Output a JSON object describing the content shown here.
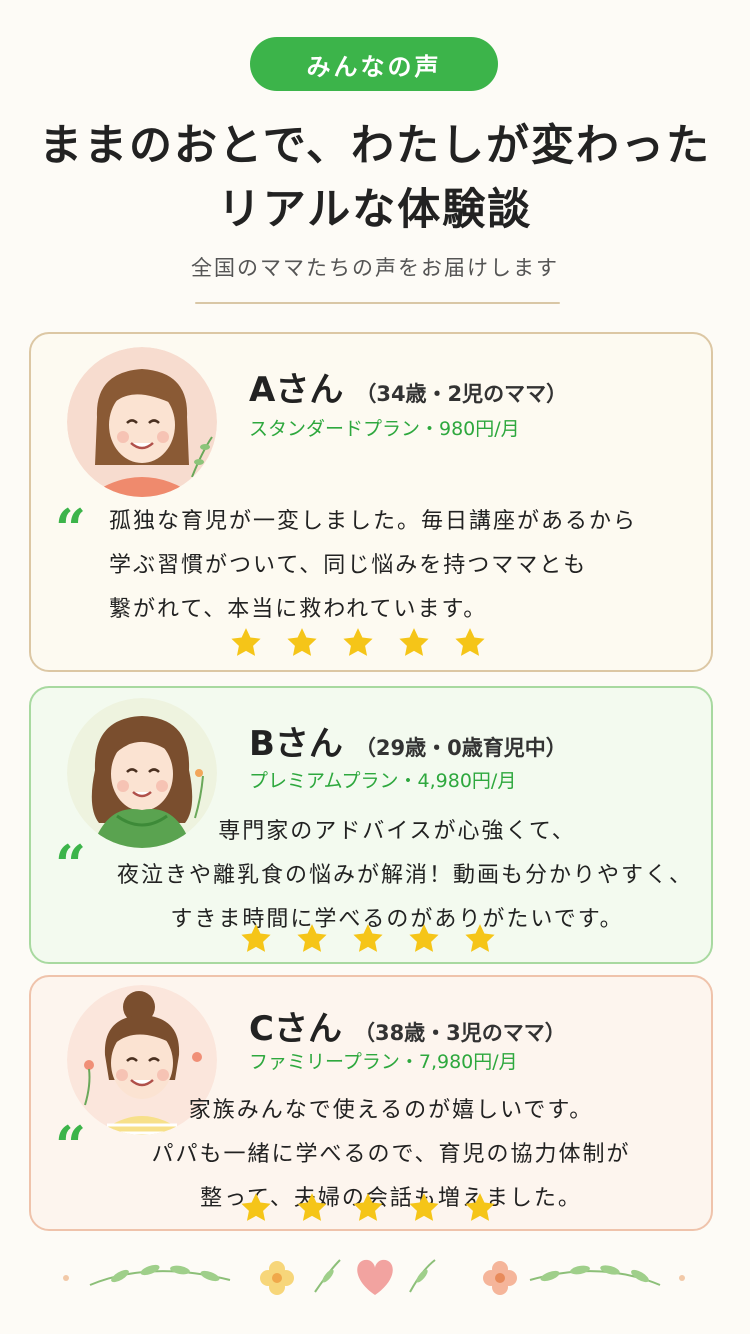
{
  "header": {
    "badge": "みんなの声",
    "title_line1": "ままのおとで、わたしが変わった",
    "title_line2": "リアルな体験談",
    "subtitle": "全国のママたちの声をお届けします"
  },
  "quote_glyph": "“",
  "testimonials": [
    {
      "name": "Aさん",
      "detail": "（34歳・2児のママ）",
      "plan": "スタンダードプラン・980円/月",
      "lines": [
        "孤独な育児が一変しました。毎日講座があるから",
        "学ぶ習慣がついて、同じ悩みを持つママとも",
        "繋がれて、本当に救われています。"
      ],
      "rating": 5
    },
    {
      "name": "Bさん",
      "detail": "（29歳・0歳育児中）",
      "plan": "プレミアムプラン・4,980円/月",
      "lines": [
        "専門家のアドバイスが心強くて、",
        "夜泣きや離乳食の悩みが解消！動画も分かりやすく、",
        "すきま時間に学べるのがありがたいです。"
      ],
      "rating": 5
    },
    {
      "name": "Cさん",
      "detail": "（38歳・3児のママ）",
      "plan": "ファミリープラン・7,980円/月",
      "lines": [
        "家族みんなで使えるのが嬉しいです。",
        "パパも一緒に学べるので、育児の協力体制が",
        "整って、夫婦の会話も増えました。"
      ],
      "rating": 5
    }
  ],
  "colors": {
    "accent_green": "#3cb44a",
    "star_yellow": "#f5c518"
  }
}
